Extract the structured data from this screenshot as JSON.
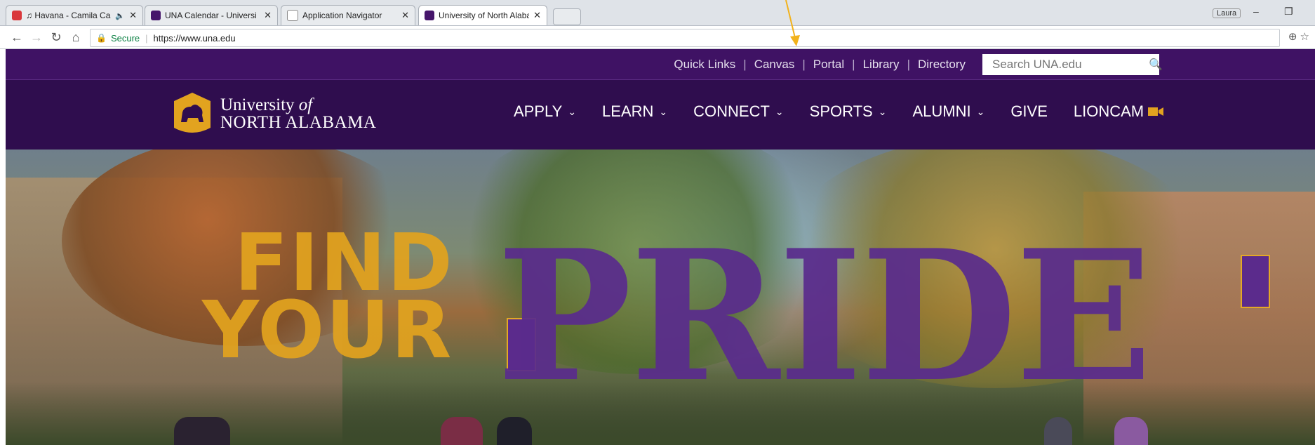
{
  "browser": {
    "tabs": [
      {
        "title": "♫ Havana - Camila Ca",
        "favicon_color": "#d9383c",
        "audio": "🔈",
        "active": false
      },
      {
        "title": "UNA Calendar - Universi",
        "favicon_color": "#46166b",
        "active": false
      },
      {
        "title": "Application Navigator",
        "favicon_color": "#ffffff",
        "active": false
      },
      {
        "title": "University of North Alaba",
        "favicon_color": "#46166b",
        "active": true
      }
    ],
    "profile_label": "Laura",
    "minimize": "–",
    "restore": "❐",
    "secure_label": "Secure",
    "url": "https://www.una.edu"
  },
  "site": {
    "quick_links": [
      "Quick Links",
      "Canvas",
      "Portal",
      "Library",
      "Directory"
    ],
    "search_placeholder": "Search UNA.edu",
    "logo": {
      "line1": "University",
      "line1b": "of",
      "line2": "NORTH ALABAMA"
    },
    "menu": [
      {
        "label": "APPLY",
        "dropdown": true
      },
      {
        "label": "LEARN",
        "dropdown": true
      },
      {
        "label": "CONNECT",
        "dropdown": true
      },
      {
        "label": "SPORTS",
        "dropdown": true
      },
      {
        "label": "ALUMNI",
        "dropdown": true
      },
      {
        "label": "GIVE",
        "dropdown": false
      },
      {
        "label": "LIONCAM",
        "dropdown": false,
        "icon": "video-camera-icon"
      }
    ],
    "hero": {
      "word1": "FIND",
      "word2": "YOUR",
      "word3": "PRIDE"
    }
  },
  "colors": {
    "purple_dark": "#2f0d4e",
    "purple_top": "#3f1264",
    "gold": "#e2a31f",
    "hero_purple": "#5a2c8d"
  }
}
